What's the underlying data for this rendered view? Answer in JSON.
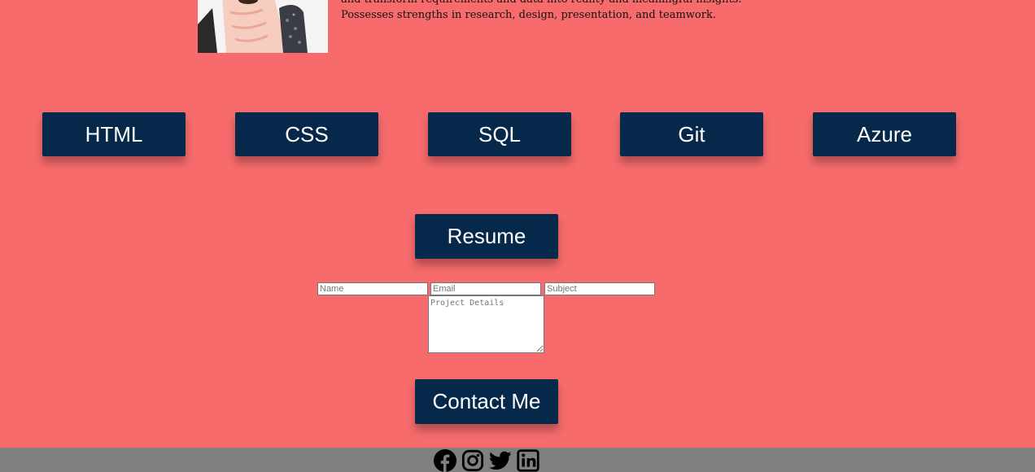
{
  "profile": {
    "bio_lines": [
      "and transform requirements and data into reality and meaningful insights.",
      "Possesses strengths in research, design, presentation, and teamwork."
    ]
  },
  "skills": [
    "HTML",
    "CSS",
    "SQL",
    "Git",
    "Azure"
  ],
  "resume_button": "Resume",
  "contact_form": {
    "name_placeholder": "Name",
    "email_placeholder": "Email",
    "subject_placeholder": "Subject",
    "details_placeholder": "Project Details",
    "submit_label": "Contact Me"
  },
  "footer": {
    "social_icons": [
      "facebook-icon",
      "instagram-icon",
      "twitter-icon",
      "linkedin-icon"
    ]
  },
  "colors": {
    "page_background": "#f76b6c",
    "button_background": "#06284a",
    "button_text": "#ffffff",
    "footer_background": "#808080",
    "icon_color": "#000000"
  }
}
